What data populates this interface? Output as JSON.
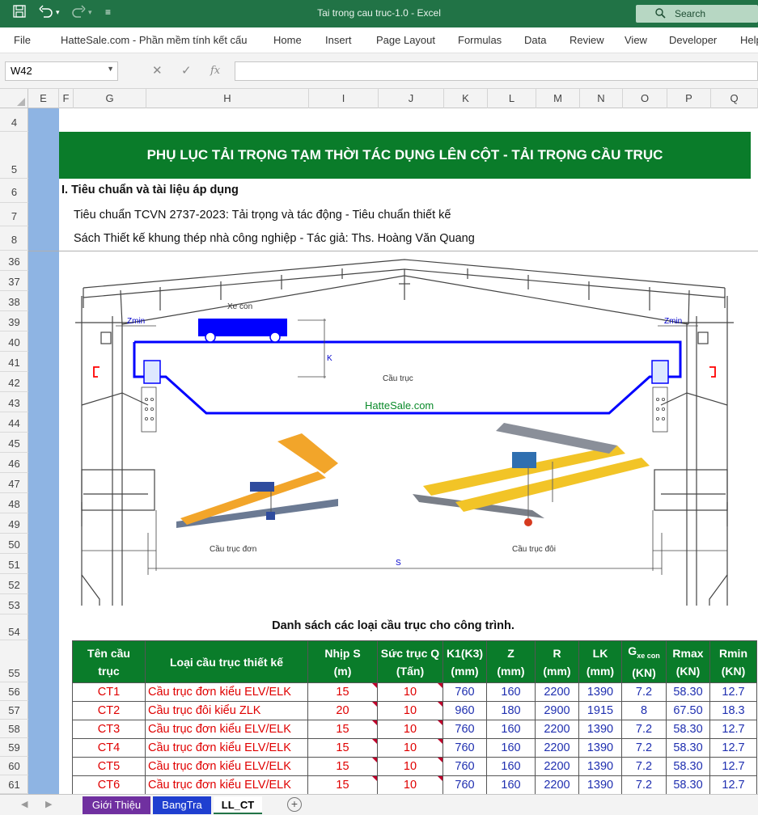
{
  "window": {
    "title": "Tai trong cau truc-1.0  -  Excel"
  },
  "quick_access": {
    "save_icon": "save-icon",
    "undo_icon": "undo-icon",
    "redo_icon": "redo-icon",
    "customize_icon": "customize-icon"
  },
  "search": {
    "label": "Search"
  },
  "ribbon_tabs": [
    "File",
    "HatteSale.com - Phần mềm tính kết cấu",
    "Home",
    "Insert",
    "Page Layout",
    "Formulas",
    "Data",
    "Review",
    "View",
    "Developer",
    "Help"
  ],
  "formula_bar": {
    "name_box": "W42",
    "formula": ""
  },
  "columns": [
    "E",
    "F",
    "G",
    "H",
    "I",
    "J",
    "K",
    "L",
    "M",
    "N",
    "O",
    "P",
    "Q"
  ],
  "rows": [
    "4",
    "5",
    "6",
    "7",
    "8",
    "36",
    "37",
    "38",
    "39",
    "40",
    "41",
    "42",
    "43",
    "44",
    "45",
    "46",
    "47",
    "48",
    "49",
    "50",
    "51",
    "52",
    "53",
    "54",
    "55",
    "56",
    "57",
    "58",
    "59",
    "60",
    "61"
  ],
  "document": {
    "banner": "PHỤ LỤC TẢI TRỌNG TẠM THỜI TÁC DỤNG LÊN CỘT - TẢI TRỌNG CẦU TRỤC",
    "section_title": "I. Tiêu chuẩn và tài liệu áp dụng",
    "line1": "Tiêu chuẩn TCVN 2737-2023: Tải trọng và tác động - Tiêu chuẩn thiết kế",
    "line2": "Sách Thiết kế khung thép nhà công nghiệp - Tác giả: Ths. Hoàng Văn Quang"
  },
  "diagram": {
    "xe_con": "Xe con",
    "zmin_left": "Zmin",
    "zmin_right": "Zmin",
    "k": "K",
    "cau_truc": "Cầu trục",
    "watermark": "HatteSale.com",
    "label_single": "Cầu trục đơn",
    "label_double": "Cầu trục đôi",
    "s": "S",
    "colors": {
      "crane": "#0000ff",
      "rail_stop": "#ff0000",
      "watermark": "#0a8a2a",
      "frame": "#444444"
    }
  },
  "table": {
    "caption": "Danh sách các loại cầu trục cho công trình.",
    "headers": [
      "Tên cầu trục",
      "Loại cầu trục thiết kế",
      "Nhịp S (m)",
      "Sức trục Q (Tấn)",
      "K1(K3) (mm)",
      "Z (mm)",
      "R (mm)",
      "LK (mm)",
      "G",
      "Rmax (KN)",
      "Rmin (KN)"
    ],
    "g_sub": "xe con",
    "g_unit": "(KN)",
    "rows": [
      [
        "CT1",
        "Cầu trục đơn kiểu ELV/ELK",
        "15",
        "10",
        "760",
        "160",
        "2200",
        "1390",
        "7.2",
        "58.30",
        "12.7"
      ],
      [
        "CT2",
        "Cầu trục đôi kiểu ZLK",
        "20",
        "10",
        "960",
        "180",
        "2900",
        "1915",
        "8",
        "67.50",
        "18.3"
      ],
      [
        "CT3",
        "Cầu trục đơn kiểu ELV/ELK",
        "15",
        "10",
        "760",
        "160",
        "2200",
        "1390",
        "7.2",
        "58.30",
        "12.7"
      ],
      [
        "CT4",
        "Cầu trục đơn kiểu ELV/ELK",
        "15",
        "10",
        "760",
        "160",
        "2200",
        "1390",
        "7.2",
        "58.30",
        "12.7"
      ],
      [
        "CT5",
        "Cầu trục đơn kiểu ELV/ELK",
        "15",
        "10",
        "760",
        "160",
        "2200",
        "1390",
        "7.2",
        "58.30",
        "12.7"
      ],
      [
        "CT6",
        "Cầu trục đơn kiểu ELV/ELK",
        "15",
        "10",
        "760",
        "160",
        "2200",
        "1390",
        "7.2",
        "58.30",
        "12.7"
      ]
    ]
  },
  "sheet_tabs": [
    {
      "label": "Giới Thiệu",
      "color": "#7030a0",
      "text_color": "#ffffff"
    },
    {
      "label": "BangTra",
      "color": "#1f3fd0",
      "text_color": "#ffffff"
    },
    {
      "label": "LL_CT",
      "color": "#ffffff",
      "text_color": "#000000"
    }
  ]
}
